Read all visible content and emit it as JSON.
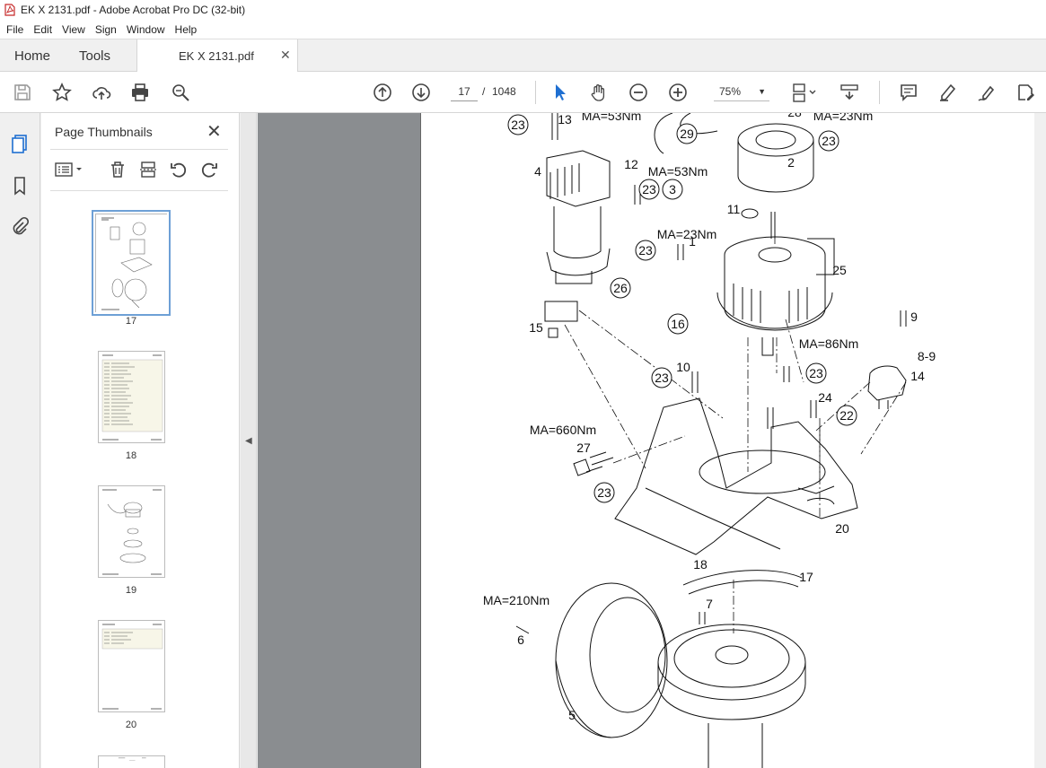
{
  "window": {
    "title": "EK X 2131.pdf - Adobe Acrobat Pro DC (32-bit)"
  },
  "menu": [
    "File",
    "Edit",
    "View",
    "Sign",
    "Window",
    "Help"
  ],
  "tabs": {
    "home": "Home",
    "tools": "Tools",
    "document": "EK X 2131.pdf"
  },
  "toolbar": {
    "current_page": "17",
    "page_separator": "/",
    "total_pages": "1048",
    "zoom": "75%"
  },
  "thumbnail_panel": {
    "title": "Page Thumbnails",
    "thumbnails": [
      {
        "label": "17",
        "selected": true
      },
      {
        "label": "18",
        "selected": false
      },
      {
        "label": "19",
        "selected": false
      },
      {
        "label": "20",
        "selected": false
      }
    ]
  },
  "drawing": {
    "callouts": [
      "23",
      "13",
      "28",
      "29",
      "2",
      "4",
      "12",
      "3",
      "11",
      "1",
      "25",
      "26",
      "16",
      "9",
      "8-9",
      "14",
      "15",
      "10",
      "24",
      "22",
      "27",
      "20",
      "18",
      "17",
      "7",
      "6",
      "5"
    ],
    "torques": [
      "MA=53Nm",
      "MA=23Nm",
      "MA=53Nm",
      "MA=23Nm",
      "MA=86Nm",
      "MA=660Nm",
      "MA=210Nm"
    ]
  }
}
